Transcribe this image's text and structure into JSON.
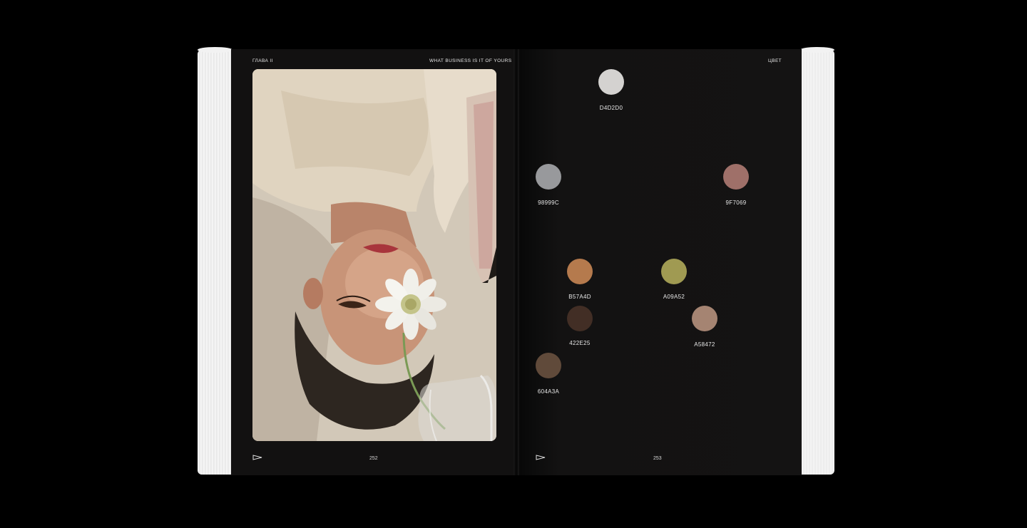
{
  "left_page": {
    "running_head_left": "ГЛАВА II",
    "running_head_right": "WHAT BUSINESS IS IT OF YOURS",
    "page_number": "252"
  },
  "right_page": {
    "running_head": "ЦВЕТ",
    "page_number": "253",
    "swatches": [
      {
        "code": "D4D2D0",
        "color": "#D4D2D0"
      },
      {
        "code": "98999C",
        "color": "#98999C"
      },
      {
        "code": "9F7069",
        "color": "#9F7069"
      },
      {
        "code": "B57A4D",
        "color": "#B57A4D"
      },
      {
        "code": "A09A52",
        "color": "#A09A52"
      },
      {
        "code": "422E25",
        "color": "#422E25"
      },
      {
        "code": "A58472",
        "color": "#A58472"
      },
      {
        "code": "604A3A",
        "color": "#604A3A"
      }
    ]
  }
}
